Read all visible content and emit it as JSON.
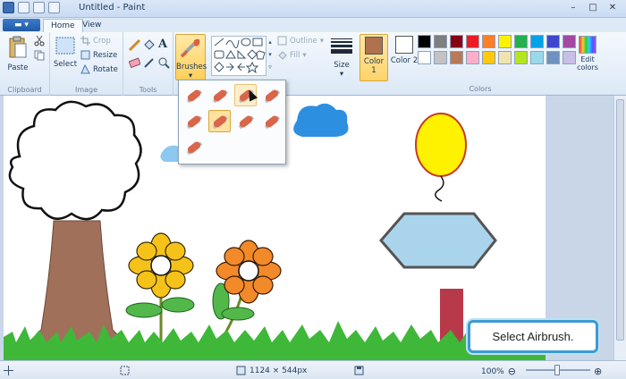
{
  "window": {
    "title": "Untitled - Paint",
    "controls": [
      "–",
      "□",
      "✕"
    ]
  },
  "tabs": {
    "file_label": "▾",
    "items": [
      "Home",
      "View"
    ]
  },
  "ribbon": {
    "clipboard": {
      "group_label": "Clipboard",
      "paste_label": "Paste"
    },
    "image": {
      "group_label": "Image",
      "select_label": "Select",
      "crop_label": "Crop",
      "resize_label": "Resize",
      "rotate_label": "Rotate"
    },
    "tools": {
      "group_label": "Tools"
    },
    "brushes": {
      "label": "Brushes"
    },
    "shapes": {
      "outline_label": "Outline",
      "fill_label": "Fill"
    },
    "size": {
      "label": "Size"
    },
    "colors": {
      "group_label": "Colors",
      "color1_label": "Color 1",
      "color1_value": "#b0714f",
      "color2_label": "Color 2",
      "color2_value": "#ffffff",
      "edit_label": "Edit colors",
      "palette": [
        "#000000",
        "#7f7f7f",
        "#880015",
        "#ed1c24",
        "#ff7f27",
        "#fff200",
        "#22b14c",
        "#00a2e8",
        "#3f48cc",
        "#a349a4",
        "#ffffff",
        "#c3c3c3",
        "#b97a57",
        "#ffaec9",
        "#ffc90e",
        "#efe4b0",
        "#b5e61d",
        "#99d9ea",
        "#7092be",
        "#c8bfe7"
      ]
    }
  },
  "brush_menu": {
    "items": [
      "brush",
      "calligraphy-brush-1",
      "calligraphy-brush-2",
      "airbrush",
      "oil-brush",
      "crayon",
      "marker",
      "natural-pencil",
      "watercolor-brush"
    ],
    "selected_index": 5,
    "hover_index": 2
  },
  "callout": {
    "text": "Select Airbrush."
  },
  "status": {
    "dimensions": "1124 × 544px",
    "zoom": "100%"
  }
}
